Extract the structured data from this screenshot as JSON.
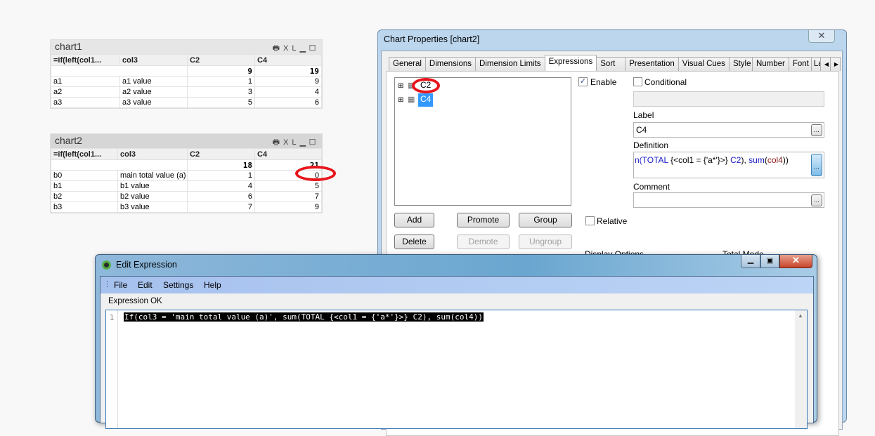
{
  "chart1": {
    "title": "chart1",
    "icons": [
      "print-icon",
      "xl-icon",
      "minimize-icon",
      "maximize-icon"
    ],
    "xl_label": "XL",
    "headers": [
      "=if(left(col1...",
      "col3",
      "C2",
      "C4"
    ],
    "totals": [
      "",
      "",
      "9",
      "19"
    ],
    "rows": [
      [
        "a1",
        "a1 value",
        "1",
        "9"
      ],
      [
        "a2",
        "a2 value",
        "3",
        "4"
      ],
      [
        "a3",
        "a3 value",
        "5",
        "6"
      ]
    ]
  },
  "chart2": {
    "title": "chart2",
    "xl_label": "XL",
    "headers": [
      "=if(left(col1...",
      "col3",
      "C2",
      "C4"
    ],
    "totals": [
      "",
      "",
      "18",
      "21"
    ],
    "rows": [
      [
        "b0",
        "main total value (a)",
        "1",
        "0"
      ],
      [
        "b1",
        "b1 value",
        "4",
        "5"
      ],
      [
        "b2",
        "b2 value",
        "6",
        "7"
      ],
      [
        "b3",
        "b3 value",
        "7",
        "9"
      ]
    ]
  },
  "props": {
    "title": "Chart Properties [chart2]",
    "tabs": [
      "General",
      "Dimensions",
      "Dimension Limits",
      "Expressions",
      "Sort",
      "Presentation",
      "Visual Cues",
      "Style",
      "Number",
      "Font",
      "La"
    ],
    "active_tab": "Expressions",
    "expressions": [
      "C2",
      "C4"
    ],
    "selected_expression": "C4",
    "enable_label": "Enable",
    "enable_checked": true,
    "conditional_label": "Conditional",
    "conditional_checked": false,
    "label_label": "Label",
    "label_value": "C4",
    "definition_label": "Definition",
    "definition_parts": {
      "p1": "n(TOTAL ",
      "p2": "{<col1 = {'a*'}>} ",
      "p3": "C2",
      "p4": "), ",
      "p5": "sum",
      "p6": "(",
      "p7": "col4",
      "p8": "))"
    },
    "comment_label": "Comment",
    "comment_value": "",
    "relative_label": "Relative",
    "relative_checked": false,
    "buttons": {
      "add": "Add",
      "promote": "Promote",
      "group": "Group",
      "delete": "Delete",
      "demote": "Demote",
      "ungroup": "Ungroup"
    },
    "display_options": "Display Options",
    "total_mode": "Total Mode",
    "ellipsis": "..."
  },
  "edit": {
    "title": "Edit Expression",
    "menu": [
      "File",
      "Edit",
      "Settings",
      "Help"
    ],
    "status": "Expression OK",
    "line_number": "1",
    "expression": "If(col3 = 'main total value (a)', sum(TOTAL {<col1 = {'a*'}>} C2), sum(col4))"
  },
  "colors": {
    "annotation": "#e8141b",
    "selection": "#3399ff",
    "title_bar": "#bcd6ee"
  }
}
